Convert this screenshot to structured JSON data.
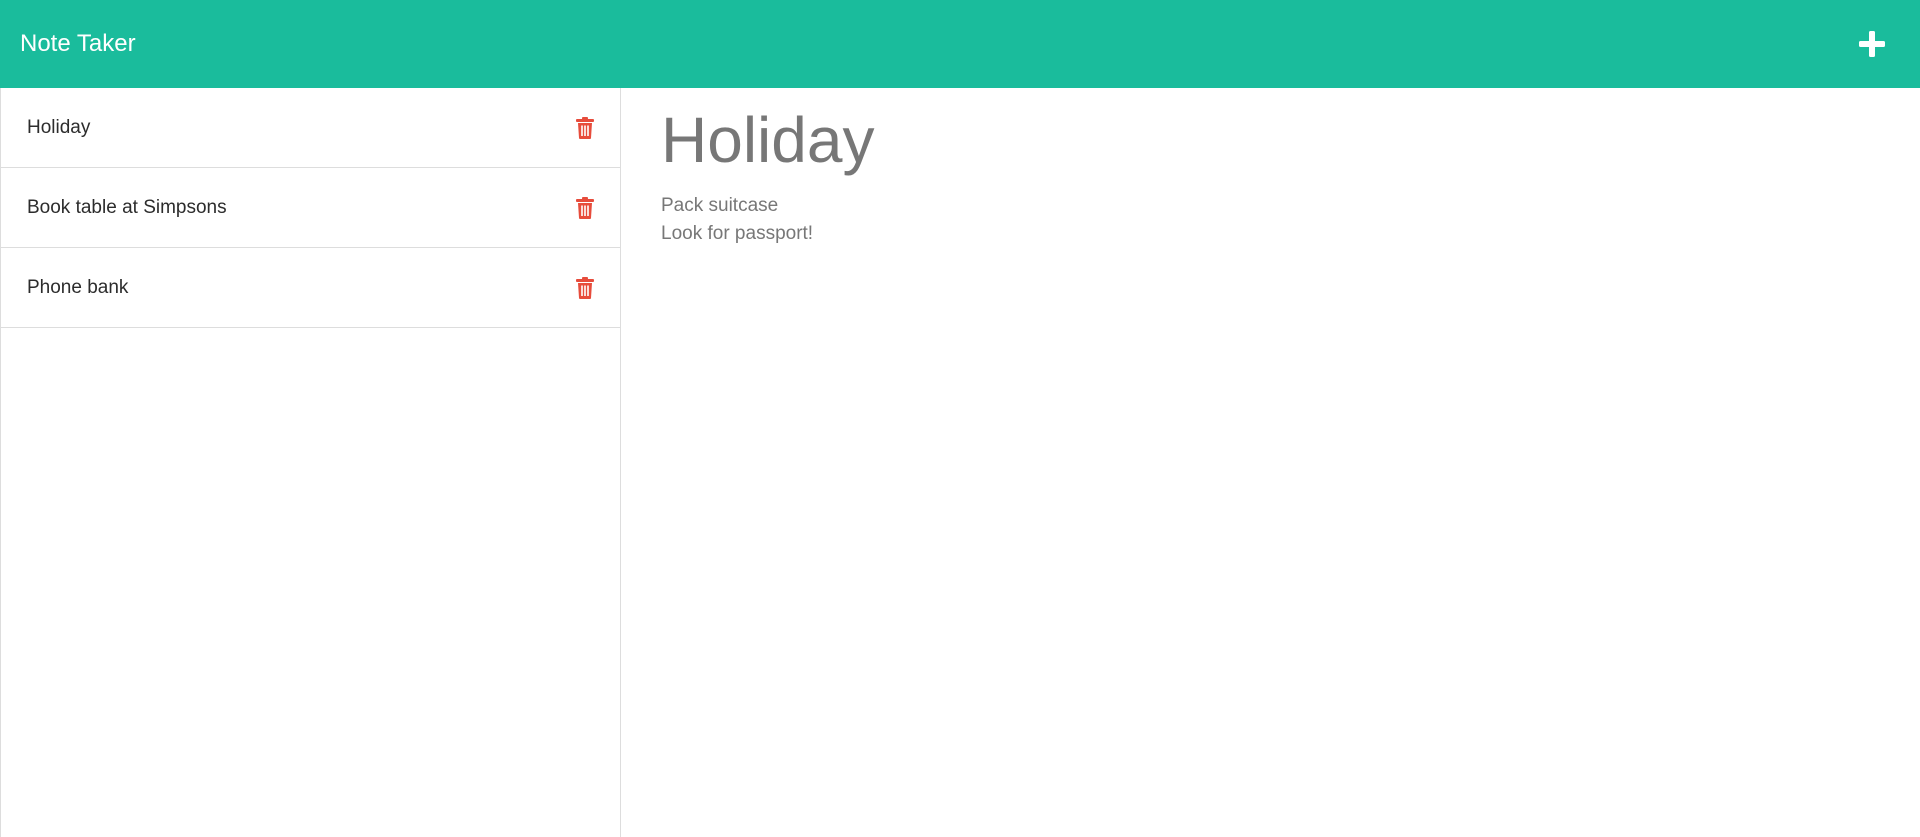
{
  "app": {
    "title": "Note Taker"
  },
  "header": {
    "add_icon": "plus-icon",
    "colors": {
      "navbar": "#1abc9c",
      "text": "#ffffff"
    }
  },
  "sidebar": {
    "notes": [
      {
        "title": "Holiday"
      },
      {
        "title": "Book table at Simpsons"
      },
      {
        "title": "Phone bank"
      }
    ],
    "delete_icon": "trash-icon",
    "delete_color": "#e74c3c"
  },
  "editor": {
    "title": "Holiday",
    "body": "Pack suitcase\nLook for passport!"
  }
}
